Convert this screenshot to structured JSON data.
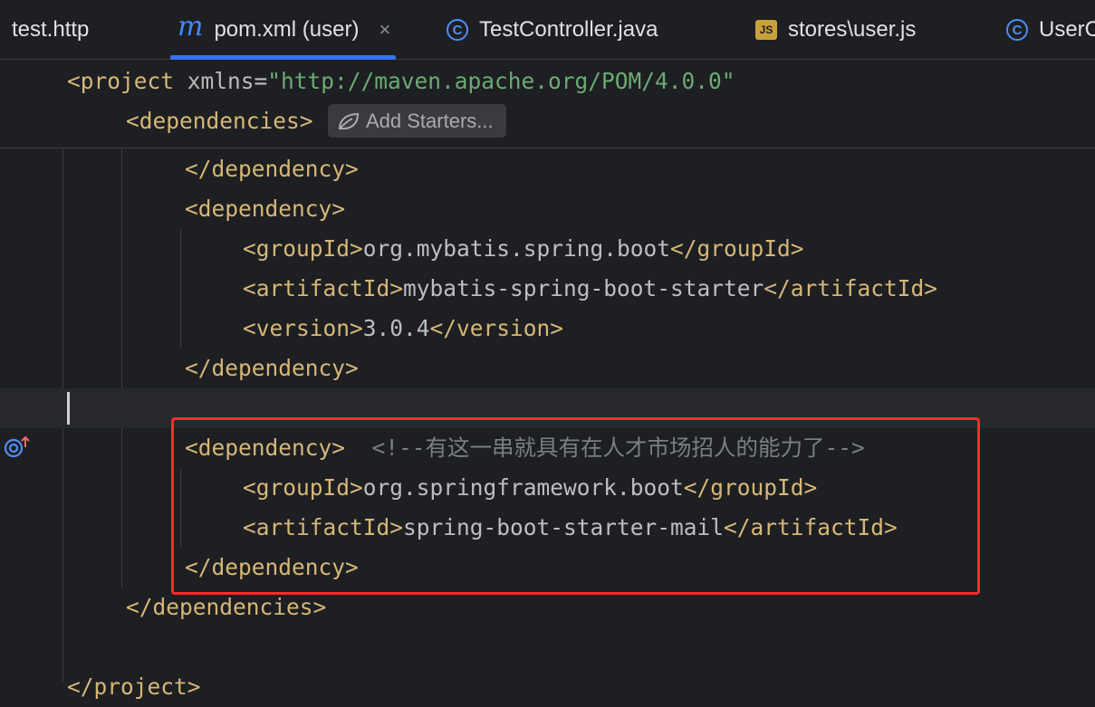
{
  "tabs": [
    {
      "label": "test.http",
      "icon": "none"
    },
    {
      "label": "pom.xml (user)",
      "icon": "maven-icon",
      "icon_glyph": "m",
      "active": true,
      "close": "×"
    },
    {
      "label": "TestController.java",
      "icon": "java-class-icon",
      "icon_glyph": "C"
    },
    {
      "label": "stores\\user.js",
      "icon": "javascript-file-icon",
      "icon_glyph": "JS"
    },
    {
      "label": "UserC",
      "icon": "java-class-icon",
      "icon_glyph": "C"
    }
  ],
  "sticky": {
    "line1": {
      "open": "<project",
      "attr": " xmlns",
      "eq": "=",
      "value": "\"http://maven.apache.org/POM/4.0.0\""
    },
    "line2": "<dependencies>",
    "add_starters": "Add Starters..."
  },
  "code_lines": {
    "l1": "</dependency>",
    "l2": "<dependency>",
    "l3": {
      "open": "<groupId>",
      "text": "org.mybatis.spring.boot",
      "close": "</groupId>"
    },
    "l4": {
      "open": "<artifactId>",
      "text": "mybatis-spring-boot-starter",
      "close": "</artifactId>"
    },
    "l5": {
      "open": "<version>",
      "text": "3.0.4",
      "close": "</version>"
    },
    "l6": "</dependency>",
    "l8": {
      "open": "<dependency>",
      "comment": "<!--有这一串就具有在人才市场招人的能力了-->"
    },
    "l9": {
      "open": "<groupId>",
      "text": "org.springframework.boot",
      "close": "</groupId>"
    },
    "l10": {
      "open": "<artifactId>",
      "text": "spring-boot-starter-mail",
      "close": "</artifactId>"
    },
    "l11": "</dependency>",
    "l12": "</dependencies>",
    "l13": "</project>"
  },
  "colors": {
    "tag": "#d5b778",
    "string": "#6aab73",
    "comment": "#7a7e85",
    "accent": "#3574f0",
    "highlight": "#ff2a2a"
  }
}
